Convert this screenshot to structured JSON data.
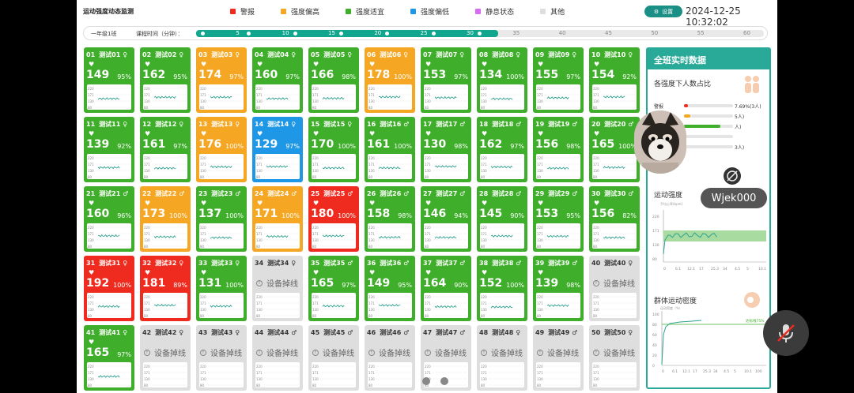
{
  "header": {
    "title": "运动强度动态监测",
    "legend": [
      {
        "label": "警报",
        "color": "#ee2b1e"
      },
      {
        "label": "强度偏高",
        "color": "#f5a622"
      },
      {
        "label": "强度适宜",
        "color": "#3fae2a"
      },
      {
        "label": "强度偏低",
        "color": "#1e97e6"
      },
      {
        "label": "静息状态",
        "color": "#d86cf0"
      },
      {
        "label": "其他",
        "color": "#dedede"
      }
    ],
    "settings_label": "设置",
    "datetime": "2024-12-25 10:32:02"
  },
  "timeline": {
    "class_name": "一年级1班",
    "label": "课程时间（分钟）：",
    "ticks": [
      "0",
      "5",
      "10",
      "15",
      "20",
      "25",
      "30",
      "35",
      "40",
      "45",
      "50",
      "55",
      "60"
    ],
    "progress_minutes": 32,
    "total_minutes": 60
  },
  "students": [
    {
      "no": "01",
      "name": "测试01",
      "sex": "female",
      "status": "green",
      "bpm": "149",
      "pct": "95%"
    },
    {
      "no": "02",
      "name": "测试02",
      "sex": "female",
      "status": "green",
      "bpm": "162",
      "pct": "95%"
    },
    {
      "no": "03",
      "name": "测试03",
      "sex": "female",
      "status": "orange",
      "bpm": "174",
      "pct": "97%"
    },
    {
      "no": "04",
      "name": "测试04",
      "sex": "female",
      "status": "green",
      "bpm": "160",
      "pct": "97%"
    },
    {
      "no": "05",
      "name": "测试05",
      "sex": "female",
      "status": "green",
      "bpm": "166",
      "pct": "98%"
    },
    {
      "no": "06",
      "name": "测试06",
      "sex": "female",
      "status": "orange",
      "bpm": "178",
      "pct": "100%"
    },
    {
      "no": "07",
      "name": "测试07",
      "sex": "female",
      "status": "green",
      "bpm": "153",
      "pct": "97%"
    },
    {
      "no": "08",
      "name": "测试08",
      "sex": "female",
      "status": "green",
      "bpm": "134",
      "pct": "100%"
    },
    {
      "no": "09",
      "name": "测试09",
      "sex": "female",
      "status": "green",
      "bpm": "155",
      "pct": "97%"
    },
    {
      "no": "10",
      "name": "测试10",
      "sex": "female",
      "status": "green",
      "bpm": "154",
      "pct": "92%"
    },
    {
      "no": "11",
      "name": "测试11",
      "sex": "female",
      "status": "green",
      "bpm": "139",
      "pct": "92%"
    },
    {
      "no": "12",
      "name": "测试12",
      "sex": "female",
      "status": "green",
      "bpm": "161",
      "pct": "97%"
    },
    {
      "no": "13",
      "name": "测试13",
      "sex": "female",
      "status": "orange",
      "bpm": "176",
      "pct": "100%"
    },
    {
      "no": "14",
      "name": "测试14",
      "sex": "female",
      "status": "blue",
      "bpm": "129",
      "pct": "97%"
    },
    {
      "no": "15",
      "name": "测试15",
      "sex": "female",
      "status": "green",
      "bpm": "170",
      "pct": "100%"
    },
    {
      "no": "16",
      "name": "测试16",
      "sex": "male",
      "status": "green",
      "bpm": "161",
      "pct": "100%"
    },
    {
      "no": "17",
      "name": "测试17",
      "sex": "male",
      "status": "green",
      "bpm": "130",
      "pct": "98%"
    },
    {
      "no": "18",
      "name": "测试18",
      "sex": "male",
      "status": "green",
      "bpm": "162",
      "pct": "97%"
    },
    {
      "no": "19",
      "name": "测试19",
      "sex": "male",
      "status": "green",
      "bpm": "156",
      "pct": "98%"
    },
    {
      "no": "20",
      "name": "测试20",
      "sex": "male",
      "status": "green",
      "bpm": "165",
      "pct": "100%"
    },
    {
      "no": "21",
      "name": "测试21",
      "sex": "male",
      "status": "green",
      "bpm": "160",
      "pct": "96%"
    },
    {
      "no": "22",
      "name": "测试22",
      "sex": "male",
      "status": "orange",
      "bpm": "173",
      "pct": "100%"
    },
    {
      "no": "23",
      "name": "测试23",
      "sex": "male",
      "status": "green",
      "bpm": "137",
      "pct": "100%"
    },
    {
      "no": "24",
      "name": "测试24",
      "sex": "male",
      "status": "orange",
      "bpm": "171",
      "pct": "100%"
    },
    {
      "no": "25",
      "name": "测试25",
      "sex": "male",
      "status": "red",
      "bpm": "180",
      "pct": "100%"
    },
    {
      "no": "26",
      "name": "测试26",
      "sex": "male",
      "status": "green",
      "bpm": "158",
      "pct": "98%"
    },
    {
      "no": "27",
      "name": "测试27",
      "sex": "male",
      "status": "green",
      "bpm": "146",
      "pct": "94%"
    },
    {
      "no": "28",
      "name": "测试28",
      "sex": "male",
      "status": "green",
      "bpm": "145",
      "pct": "90%"
    },
    {
      "no": "29",
      "name": "测试29",
      "sex": "male",
      "status": "green",
      "bpm": "153",
      "pct": "95%"
    },
    {
      "no": "30",
      "name": "测试30",
      "sex": "male",
      "status": "green",
      "bpm": "156",
      "pct": "82%"
    },
    {
      "no": "31",
      "name": "测试31",
      "sex": "female",
      "status": "red",
      "bpm": "192",
      "pct": "100%"
    },
    {
      "no": "32",
      "name": "测试32",
      "sex": "female",
      "status": "red",
      "bpm": "181",
      "pct": "89%"
    },
    {
      "no": "33",
      "name": "测试33",
      "sex": "female",
      "status": "green",
      "bpm": "131",
      "pct": "100%"
    },
    {
      "no": "34",
      "name": "测试34",
      "sex": "female",
      "status": "off",
      "offline": "设备掉线"
    },
    {
      "no": "35",
      "name": "测试35",
      "sex": "male",
      "status": "green",
      "bpm": "165",
      "pct": "97%"
    },
    {
      "no": "36",
      "name": "测试36",
      "sex": "male",
      "status": "green",
      "bpm": "149",
      "pct": "95%"
    },
    {
      "no": "37",
      "name": "测试37",
      "sex": "male",
      "status": "green",
      "bpm": "164",
      "pct": "90%"
    },
    {
      "no": "38",
      "name": "测试38",
      "sex": "male",
      "status": "green",
      "bpm": "152",
      "pct": "100%"
    },
    {
      "no": "39",
      "name": "测试39",
      "sex": "male",
      "status": "green",
      "bpm": "139",
      "pct": "98%"
    },
    {
      "no": "40",
      "name": "测试40",
      "sex": "female",
      "status": "off",
      "offline": "设备掉线"
    },
    {
      "no": "41",
      "name": "测试41",
      "sex": "female",
      "status": "green",
      "bpm": "165",
      "pct": "97%"
    },
    {
      "no": "42",
      "name": "测试42",
      "sex": "female",
      "status": "off",
      "offline": "设备掉线"
    },
    {
      "no": "43",
      "name": "测试43",
      "sex": "female",
      "status": "off",
      "offline": "设备掉线"
    },
    {
      "no": "44",
      "name": "测试44",
      "sex": "male",
      "status": "off",
      "offline": "设备掉线"
    },
    {
      "no": "45",
      "name": "测试45",
      "sex": "male",
      "status": "off",
      "offline": "设备掉线"
    },
    {
      "no": "46",
      "name": "测试46",
      "sex": "male",
      "status": "off",
      "offline": "设备掉线"
    },
    {
      "no": "47",
      "name": "测试47",
      "sex": "male",
      "status": "off",
      "offline": "设备掉线"
    },
    {
      "no": "48",
      "name": "测试48",
      "sex": "female",
      "status": "off",
      "offline": "设备掉线"
    },
    {
      "no": "49",
      "name": "测试49",
      "sex": "male",
      "status": "off",
      "offline": "设备掉线"
    },
    {
      "no": "50",
      "name": "测试50",
      "sex": "female",
      "status": "off",
      "offline": "设备掉线"
    }
  ],
  "mini_chart_ticks": [
    "220",
    "171",
    "130",
    "80"
  ],
  "panel": {
    "title": "全班实时数据",
    "dist_title": "各强度下人数占比",
    "dist": [
      {
        "label": "警报",
        "value": "7.69%(3人)",
        "fraction": 0.08,
        "color": "#ee2b1e"
      },
      {
        "label": "强度偏高",
        "value": "5人)",
        "fraction": 0.13,
        "color": "#f5a622"
      },
      {
        "label": "强度适宜",
        "value": "人)",
        "fraction": 0.74,
        "color": "#3fae2a"
      },
      {
        "label": "强度偏低",
        "value": "",
        "fraction": 0.03,
        "color": "#1e97e6"
      },
      {
        "label": "静息状态",
        "value": "3人)",
        "fraction": 0.0,
        "color": "#d86cf0"
      }
    ],
    "intensity_title": "运动强度",
    "intensity_ylabel": "平均心率(bpm)",
    "intensity_yticks": [
      "220",
      "171",
      "130",
      "80"
    ],
    "intensity_xticks": [
      "0",
      "6.1",
      "12.1",
      "17",
      "25.3",
      "34",
      "4.5",
      "5",
      "10.1"
    ],
    "density_title": "群体运动密度",
    "density_ylabel": "运动密度（%）",
    "density_yticks": [
      "100",
      "80",
      "60",
      "40",
      "20",
      "0"
    ],
    "density_xticks": [
      "0",
      "6.1",
      "12.1",
      "17",
      "25.3",
      "34",
      "4.5",
      "5",
      "10.1"
    ],
    "density_target": "达标线75%",
    "density_current": "100"
  },
  "overlay": {
    "participant_name": "Wjek000"
  }
}
